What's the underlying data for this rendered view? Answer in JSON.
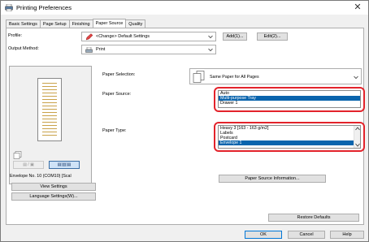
{
  "window": {
    "title": "Printing Preferences"
  },
  "tabs": [
    {
      "label": "Basic Settings"
    },
    {
      "label": "Page Setup"
    },
    {
      "label": "Finishing"
    },
    {
      "label": "Paper Source"
    },
    {
      "label": "Quality"
    }
  ],
  "profile": {
    "label": "Profile:",
    "value": "<Change> Default Settings",
    "add_button": "Add(1)...",
    "edit_button": "Edit(2)..."
  },
  "output_method": {
    "label": "Output Method:",
    "value": "Print"
  },
  "preview": {
    "caption": "Envelope No. 10 (COM10) [Scal",
    "toolbar_left_glyph": "▤ / ▣",
    "toolbar_right_glyph": "▤|▥|▤"
  },
  "paper_selection": {
    "label": "Paper Selection:",
    "value": "Same Paper for All Pages"
  },
  "paper_source": {
    "label": "Paper Source:",
    "options": [
      "Auto",
      "Multi-purpose Tray",
      "Drawer 1"
    ],
    "selected_index": 1
  },
  "paper_type": {
    "label": "Paper Type:",
    "options": [
      "Heavy 3 [163 - 163 g/m2]",
      "Labels",
      "Postcard",
      "Envelope 1"
    ],
    "selected_index": 3
  },
  "buttons": {
    "paper_source_info": "Paper Source Information...",
    "view_settings": "View Settings",
    "language_settings": "Language Settings(W)...",
    "restore_defaults": "Restore Defaults",
    "ok": "OK",
    "cancel": "Cancel",
    "help": "Help"
  },
  "colors": {
    "selection": "#0a64ad",
    "highlight_ring": "#e3232b"
  }
}
